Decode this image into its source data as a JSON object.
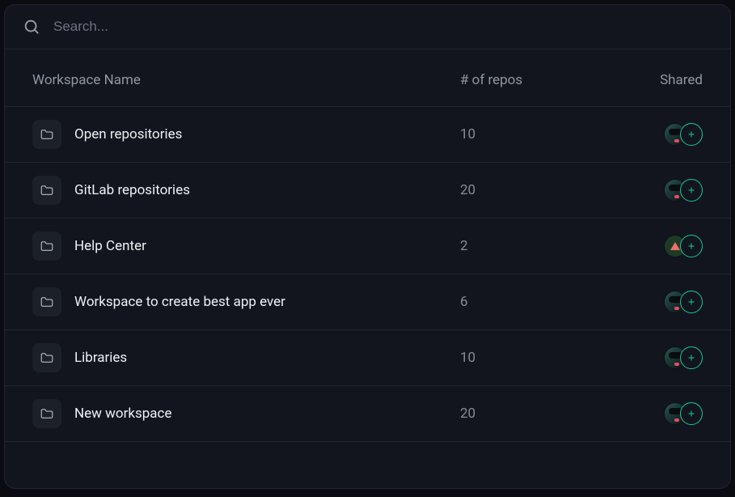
{
  "search": {
    "placeholder": "Search..."
  },
  "header": {
    "name": "Workspace Name",
    "repos": "# of repos",
    "shared": "Shared"
  },
  "rows": [
    {
      "name": "Open repositories",
      "repos": "10",
      "avatar": "person"
    },
    {
      "name": "GitLab repositories",
      "repos": "20",
      "avatar": "person"
    },
    {
      "name": "Help Center",
      "repos": "2",
      "avatar": "triangle"
    },
    {
      "name": "Workspace to create best app ever",
      "repos": "6",
      "avatar": "person"
    },
    {
      "name": "Libraries",
      "repos": "10",
      "avatar": "person"
    },
    {
      "name": "New workspace",
      "repos": "20",
      "avatar": "person"
    }
  ],
  "colors": {
    "accent": "#16c89a"
  }
}
